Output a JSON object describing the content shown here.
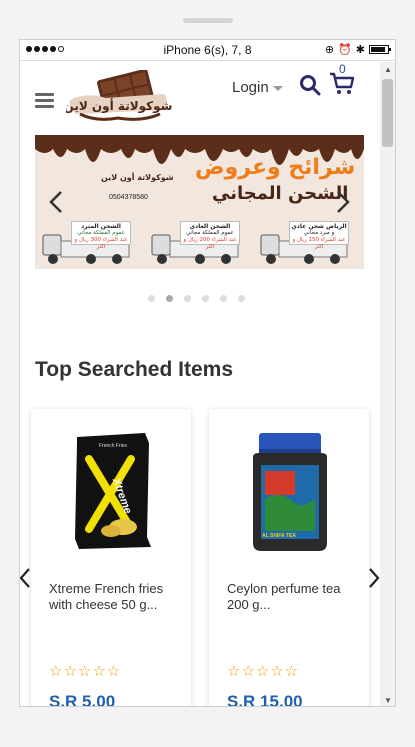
{
  "device": {
    "model": "iPhone 6(s), 7, 8"
  },
  "header": {
    "logo_text": "شوكولاتة أون لاين",
    "login_label": "Login",
    "cart_count": "0"
  },
  "banner": {
    "headline": "شرائح وعروض",
    "headline2": "الشحن المجاني",
    "logo_text": "شوكولاتة أون لاين",
    "phone": "0504378580",
    "trucks": [
      {
        "l1": "الشحن المبرد",
        "l2": "عموم المملكة مجاني",
        "l3": "عند الشراء 300 ريال و اكثر"
      },
      {
        "l1": "الشحن العادي",
        "l2": "عموم المملكة مجاني",
        "l3": "عند الشراء 200 ريال و اكثر"
      },
      {
        "l1": "الرياض شحن عادي",
        "l2": "و مبرد مجاني",
        "l3": "عند الشراء 150 ريال و اكثر"
      }
    ],
    "slide_count": 6,
    "active_slide": 2
  },
  "section": {
    "title": "Top Searched Items"
  },
  "products": [
    {
      "name": "Xtreme French fries with cheese 50 g...",
      "rating": 0,
      "stars": "☆☆☆☆☆",
      "price": "S.R 5.00",
      "pack_text": "Xtreme"
    },
    {
      "name": "Ceylon perfume tea 200 g...",
      "rating": 0,
      "stars": "☆☆☆☆☆",
      "price": "S.R 15.00",
      "pack_text": "AL SHIFA TEA"
    }
  ],
  "colors": {
    "accent_blue": "#1f5fad",
    "star": "#e8a317",
    "banner_orange": "#ef7d1a",
    "chocolate": "#4a2515"
  }
}
